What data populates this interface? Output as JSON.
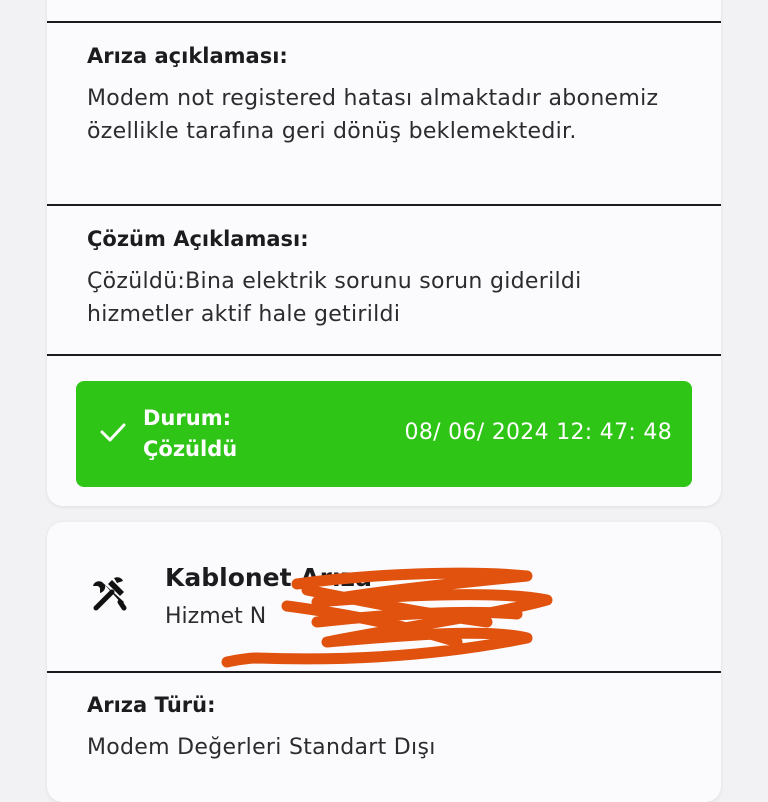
{
  "card1": {
    "fault_description": {
      "title": "Arıza açıklaması:",
      "text": "Modem not registered hatası almaktadır abonemiz özellikle tarafına geri dönüş beklemektedir."
    },
    "solution_description": {
      "title": "Çözüm Açıklaması:",
      "text": "Çözüldü:Bina elektrik sorunu sorun giderildi hizmetler aktif hale getirildi"
    },
    "status": {
      "label_line1": "Durum:",
      "label_line2": "Çözüldü",
      "timestamp": "08/ 06/ 2024 12: 47: 48",
      "color": "#2fc516"
    }
  },
  "card2": {
    "service_title": "Kablonet Arıza",
    "service_subtitle": "Hizmet N",
    "icon": "tools-icon",
    "fault_type": {
      "title": "Arıza Türü:",
      "text": "Modem Değerleri Standart Dışı"
    },
    "redaction_color": "#e0520e"
  }
}
